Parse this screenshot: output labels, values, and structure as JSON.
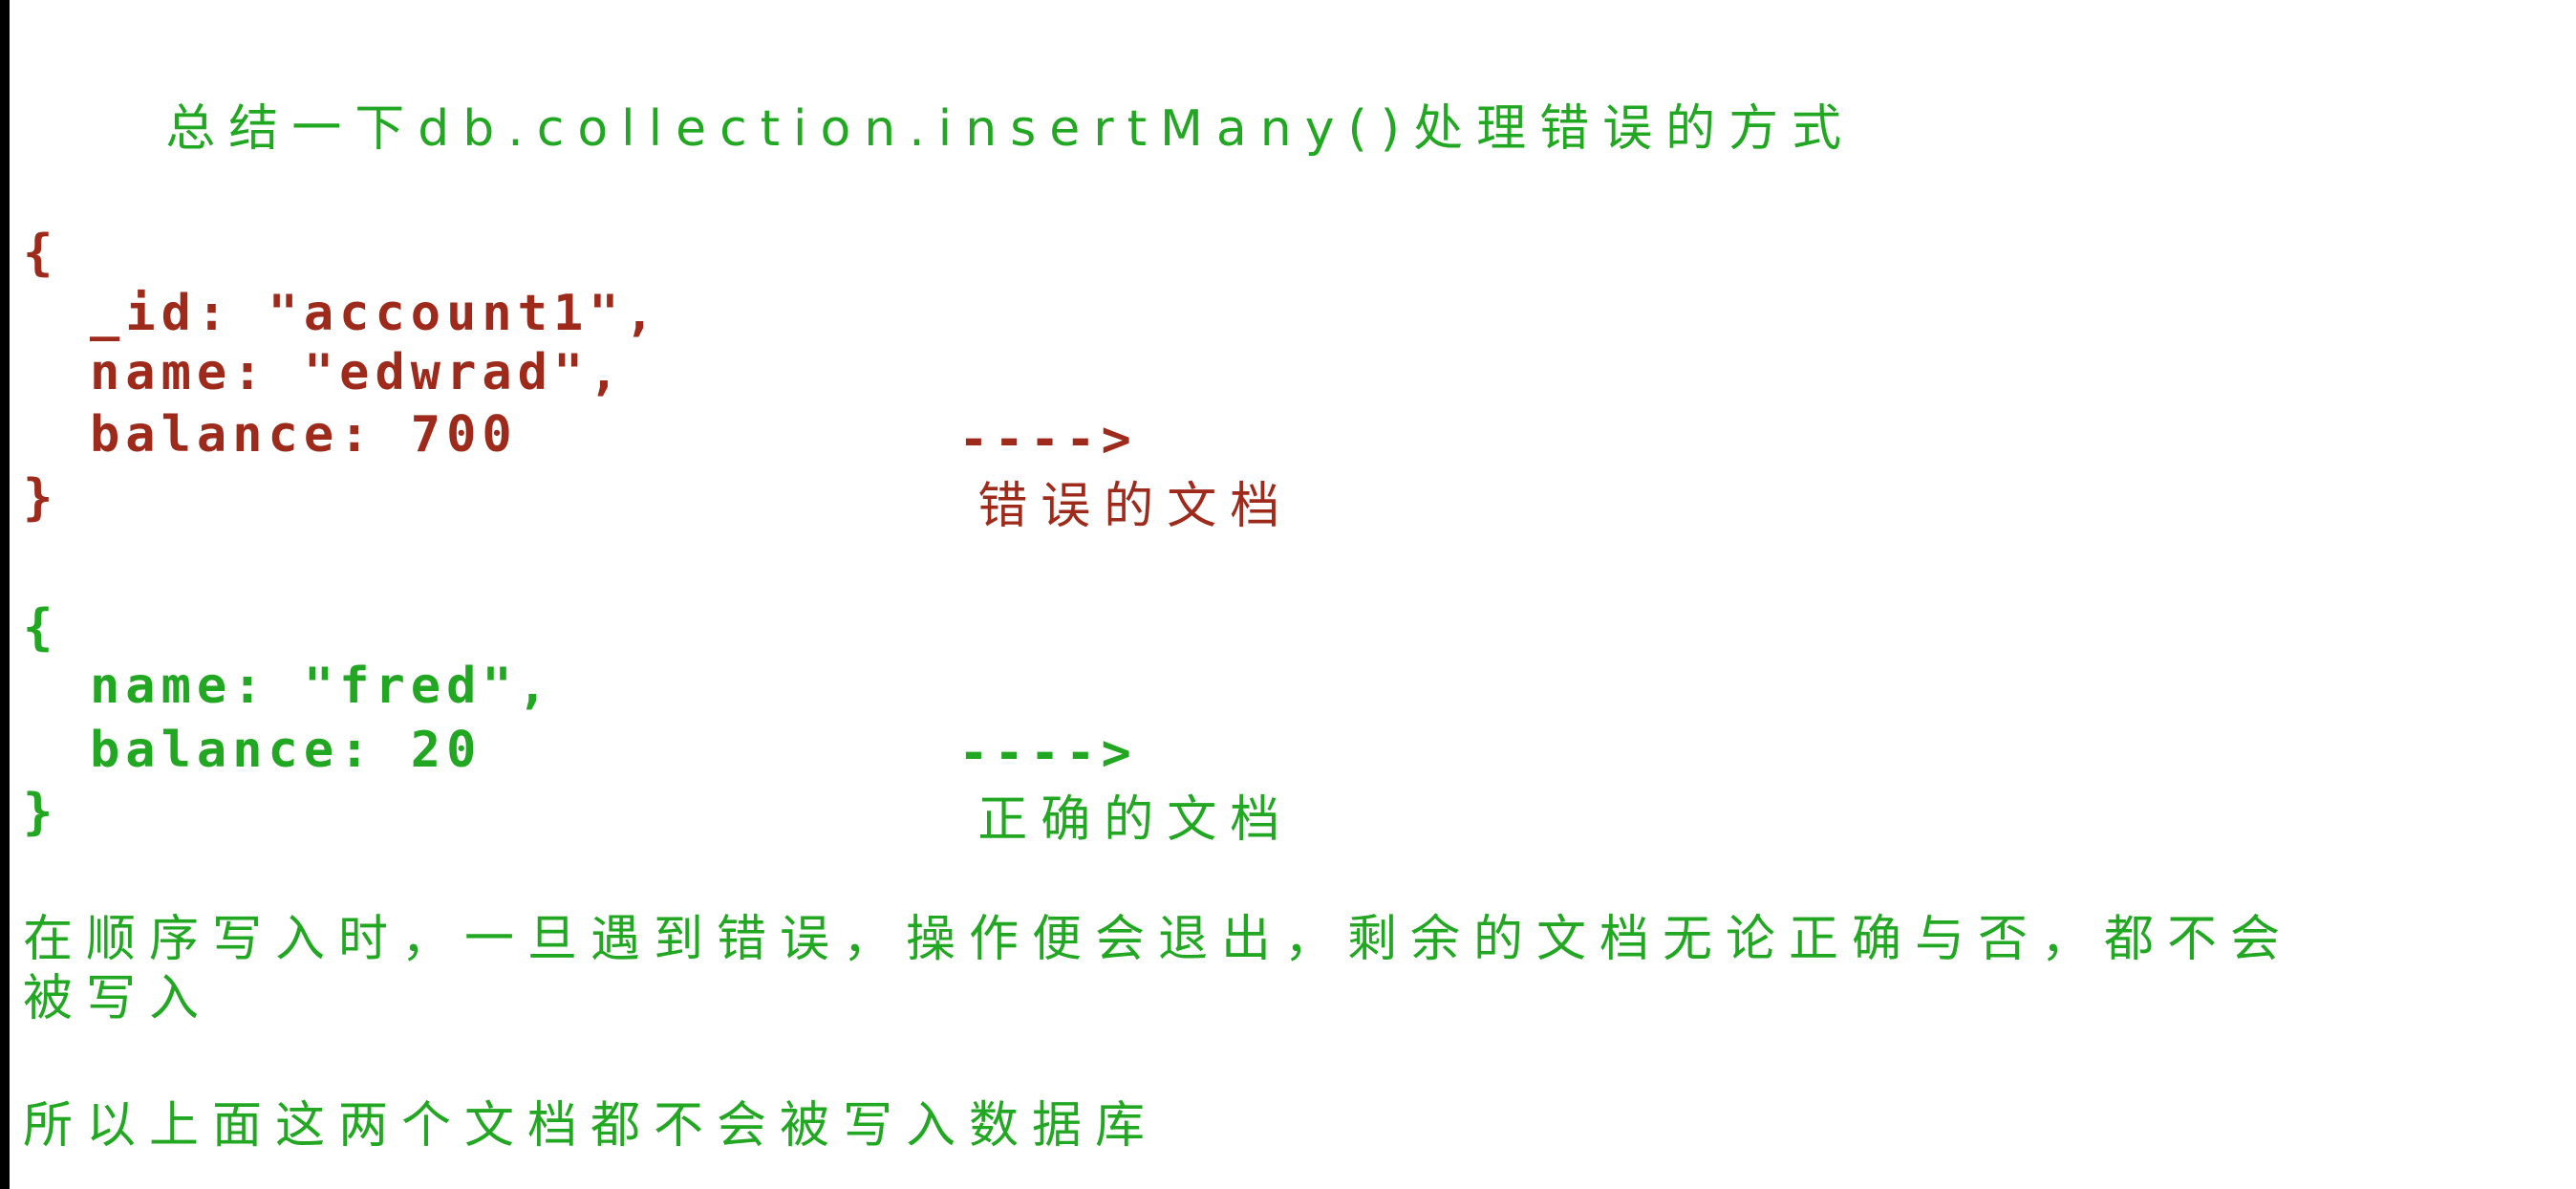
{
  "title": "总结一下db.collection.insertMany()处理错误的方式",
  "doc1": {
    "open": "{",
    "id_line": "_id: \"account1\",",
    "name_line": "name: \"edwrad\",",
    "balance_line": "balance: 700",
    "close": "}",
    "arrow": "---->",
    "label": "错误的文档"
  },
  "doc2": {
    "open": "{",
    "name_line": "name: \"fred\",",
    "balance_line": "balance: 20",
    "close": "}",
    "arrow": "---->",
    "label": "正确的文档"
  },
  "paragraph1_line1": "在顺序写入时，一旦遇到错误，操作便会退出，剩余的文档无论正确与否，都不会",
  "paragraph1_line2": "被写入",
  "paragraph2": "所以上面这两个文档都不会被写入数据库",
  "colors": {
    "green": "#22a722",
    "red": "#9e2a1c"
  }
}
